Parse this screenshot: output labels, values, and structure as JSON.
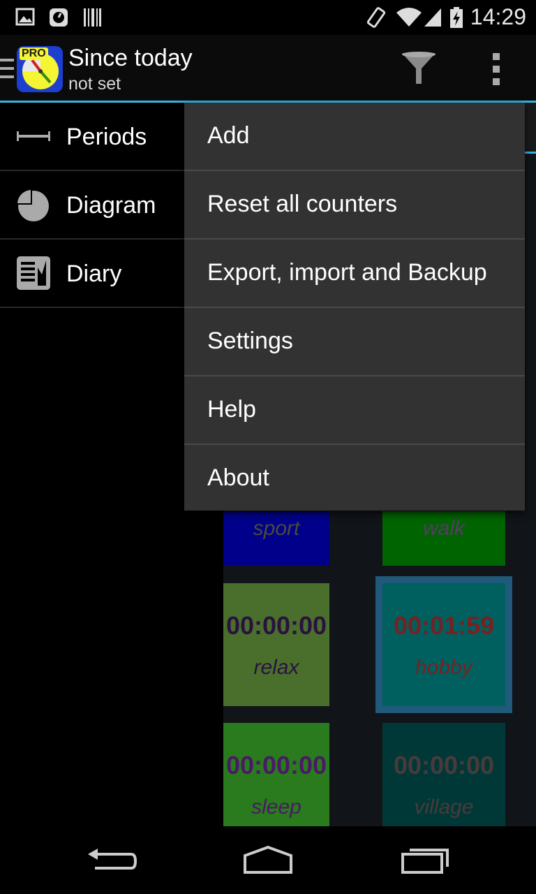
{
  "status_bar": {
    "time": "14:29",
    "icons": [
      "image-icon",
      "clock-icon",
      "barcode-icon",
      "screen-rotation-icon",
      "wifi-icon",
      "signal-icon",
      "battery-charging-icon"
    ]
  },
  "action_bar": {
    "title": "Since today",
    "subtitle": "not set",
    "logo_badge": "PRO",
    "icons": [
      "app-logo-icon",
      "filter-icon",
      "overflow-menu-icon"
    ],
    "accent_color": "#33b5e5"
  },
  "drawer": {
    "items": [
      {
        "label": "Periods",
        "icon": "period-icon"
      },
      {
        "label": "Diagram",
        "icon": "pie-chart-icon"
      },
      {
        "label": "Diary",
        "icon": "diary-icon"
      }
    ]
  },
  "menu": {
    "items": [
      {
        "label": "Add"
      },
      {
        "label": "Reset all counters"
      },
      {
        "label": "Export, import and Backup"
      },
      {
        "label": "Settings"
      },
      {
        "label": "Help"
      },
      {
        "label": "About"
      }
    ]
  },
  "tiles": [
    {
      "name": "sport",
      "time": "",
      "bg": "#00008b",
      "text": "#4a4a3a"
    },
    {
      "name": "walk",
      "time": "",
      "bg": "#006400",
      "text": "#5a3a6a"
    },
    {
      "name": "relax",
      "time": "00:00:00",
      "bg": "#4a6e2c",
      "text": "#2a1240"
    },
    {
      "name": "hobby",
      "time": "00:01:59",
      "bg": "#006060",
      "text": "#7a2020",
      "selected": true
    },
    {
      "name": "sleep",
      "time": "00:00:00",
      "bg": "#2a7a1e",
      "text": "#4a1a66"
    },
    {
      "name": "village",
      "time": "00:00:00",
      "bg": "#003838",
      "text": "#4a3a3a"
    }
  ],
  "nav_bar": {
    "icons": [
      "back-icon",
      "home-icon",
      "recent-apps-icon"
    ]
  }
}
